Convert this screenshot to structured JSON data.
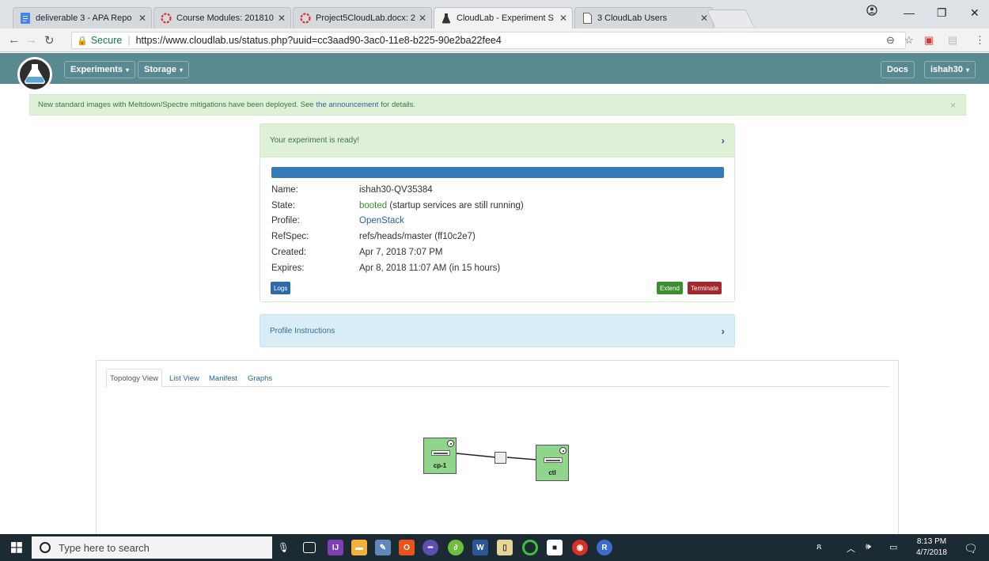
{
  "browser": {
    "tabs": [
      {
        "title": "deliverable 3 - APA Repo",
        "icon": "docs-icon",
        "active": false
      },
      {
        "title": "Course Modules: 201810",
        "icon": "canvas-icon",
        "active": false
      },
      {
        "title": "Project5CloudLab.docx: 2",
        "icon": "canvas-icon",
        "active": false
      },
      {
        "title": "CloudLab - Experiment S",
        "icon": "cloudlab-icon",
        "active": true
      },
      {
        "title": "3 CloudLab Users",
        "icon": "page-icon",
        "active": false
      }
    ],
    "secure_label": "Secure",
    "url": "https://www.cloudlab.us/status.php?uuid=cc3aad90-3ac0-11e8-b225-90e2ba22fee4"
  },
  "navbar": {
    "experiments_label": "Experiments",
    "storage_label": "Storage",
    "docs_label": "Docs",
    "user_label": "ishah30"
  },
  "alert": {
    "text_before": "New standard images with Meltdown/Spectre mitigations have been deployed. See",
    "link_text": "the announcement",
    "text_after": "for details.",
    "close": "×"
  },
  "status_panel": {
    "header": "Your experiment is ready!",
    "progress_percent": 100,
    "fields": {
      "name_label": "Name:",
      "name_value": "ishah30-QV35384",
      "state_label": "State:",
      "state_status": "booted",
      "state_note": "(startup services are still running)",
      "profile_label": "Profile:",
      "profile_value": "OpenStack",
      "refspec_label": "RefSpec:",
      "refspec_value": "refs/heads/master (ff10c2e7)",
      "created_label": "Created:",
      "created_value": "Apr 7, 2018 7:07 PM",
      "expires_label": "Expires:",
      "expires_value": "Apr 8, 2018 11:07 AM (in 15 hours)"
    },
    "logs_label": "Logs",
    "extend_label": "Extend",
    "terminate_label": "Terminate"
  },
  "instructions_panel": {
    "header": "Profile Instructions"
  },
  "topology": {
    "tabs": [
      "Topology View",
      "List View",
      "Manifest",
      "Graphs"
    ],
    "nodes": [
      {
        "label": "cp-1"
      },
      {
        "label": "ctl"
      }
    ]
  },
  "taskbar": {
    "search_placeholder": "Type here to search",
    "time": "8:13 PM",
    "date": "4/7/2018"
  },
  "colors": {
    "navbar": "#5a8a91",
    "success": "#dff0d8",
    "info": "#d9edf7",
    "primary": "#337ab7",
    "extend": "#3c8d2f",
    "terminate": "#a3272b",
    "node": "#8fd58a"
  }
}
